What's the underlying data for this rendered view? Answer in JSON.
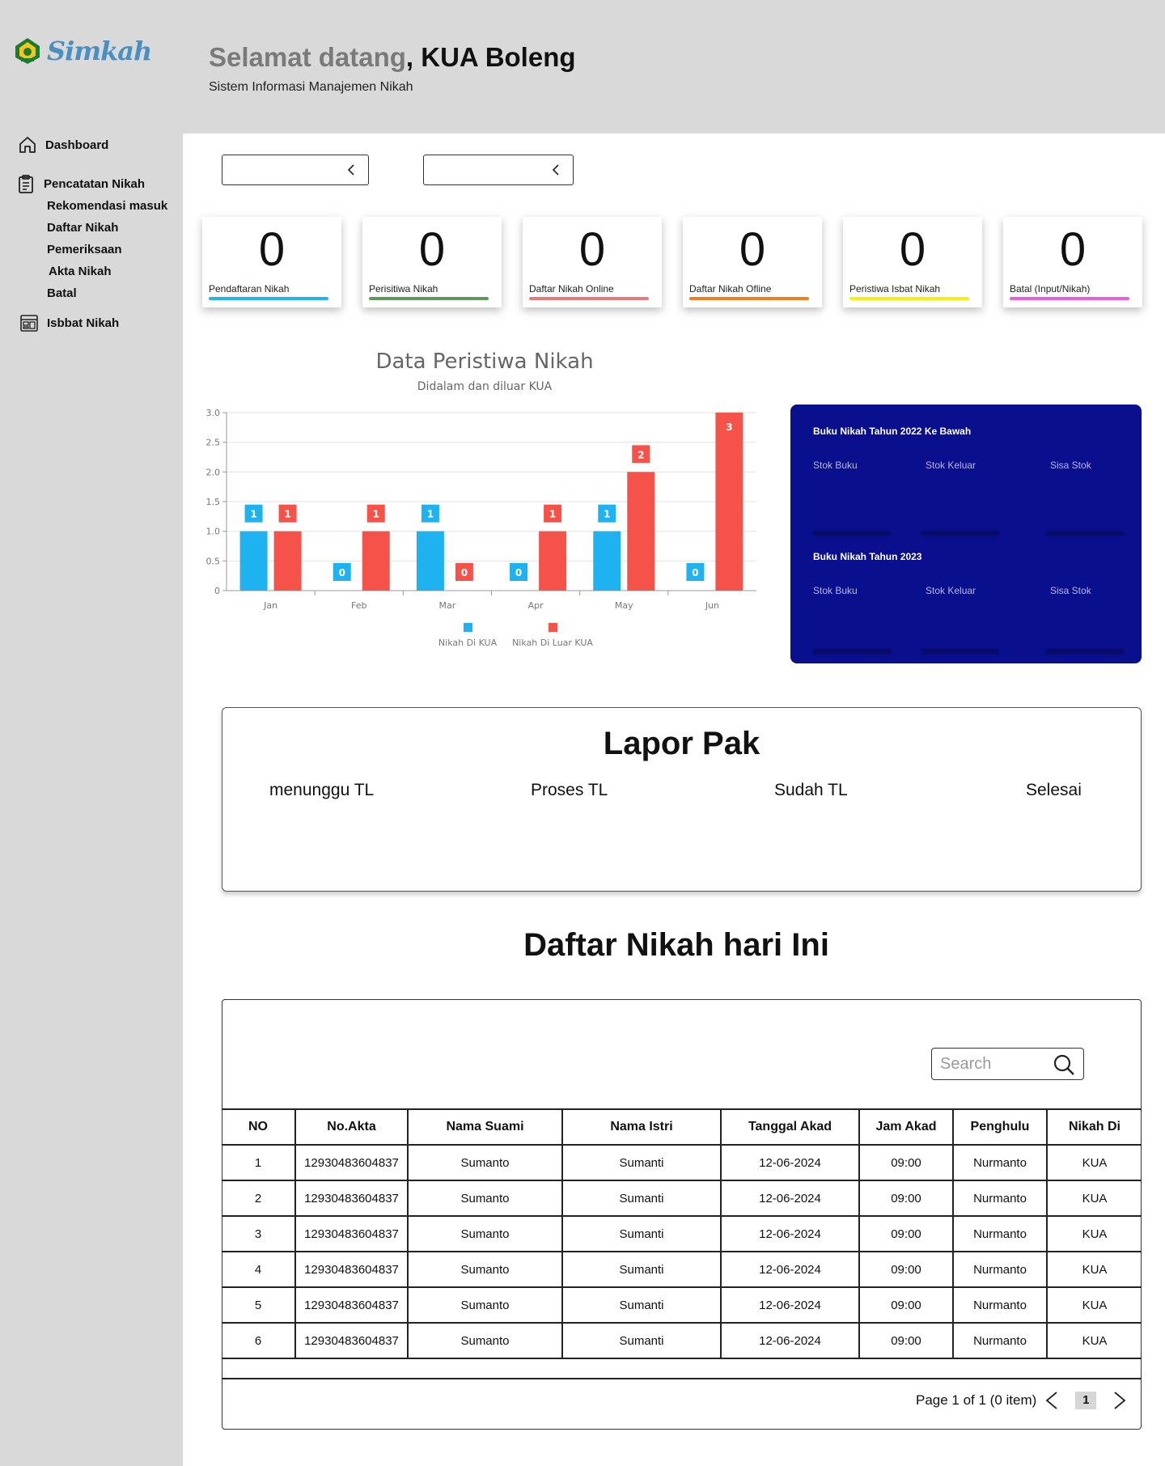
{
  "header": {
    "logo_text": "Simkah",
    "welcome_grey": "Selamat datang",
    "welcome_dark": ", KUA Boleng",
    "subtitle": "Sistem Informasi Manajemen Nikah"
  },
  "sidebar": {
    "dashboard": "Dashboard",
    "pencatatan": "Pencatatan Nikah",
    "subs": [
      "Rekomendasi masuk",
      "Daftar Nikah",
      "Pemeriksaan",
      "Akta Nikah",
      "Batal"
    ],
    "isbbat": "Isbbat Nikah"
  },
  "stats": [
    {
      "value": "0",
      "label": "Pendaftaran Nikah",
      "color": "#1fb6ec"
    },
    {
      "value": "0",
      "label": "Perisitiwa Nikah",
      "color": "#5c9a59"
    },
    {
      "value": "0",
      "label": "Daftar Nikah Online",
      "color": "#e77a7a"
    },
    {
      "value": "0",
      "label": "Daftar Nikah Ofline",
      "color": "#ef7f1a"
    },
    {
      "value": "0",
      "label": "Peristiwa Isbat Nikah",
      "color": "#f2f20c"
    },
    {
      "value": "0",
      "label": "Batal (Input/Nikah)",
      "color": "#e75ee0"
    }
  ],
  "chart_data": {
    "type": "bar",
    "title": "Data Peristiwa Nikah",
    "subtitle": "Didalam dan diluar KUA",
    "categories": [
      "Jan",
      "Feb",
      "Mar",
      "Apr",
      "May",
      "Jun"
    ],
    "series": [
      {
        "name": "Nikah Di KUA",
        "values": [
          1,
          0,
          1,
          0,
          1,
          0
        ],
        "color": "#1fb2f0"
      },
      {
        "name": "Nikah Di Luar KUA",
        "values": [
          1,
          1,
          0,
          1,
          2,
          3
        ],
        "color": "#f5534a"
      }
    ],
    "ylim": [
      0,
      3
    ],
    "yticks": [
      "0",
      "0.5",
      "1.0",
      "1.5",
      "2.0",
      "2.5",
      "3.0"
    ],
    "grid": true,
    "legend": "bottom"
  },
  "stock": {
    "section1": "Buku Nikah Tahun 2022 Ke Bawah",
    "section2": "Buku Nikah Tahun 2023",
    "cols": [
      "Stok Buku",
      "Stok Keluar",
      "Sisa Stok"
    ],
    "bg": "#0a0f8e"
  },
  "lapor": {
    "title": "Lapor Pak",
    "items": [
      "menunggu TL",
      "Proses TL",
      "Sudah TL",
      "Selesai"
    ]
  },
  "daftar_title": "Daftar Nikah hari Ini",
  "search_placeholder": "Search",
  "table": {
    "headers": [
      "NO",
      "No.Akta",
      "Nama Suami",
      "Nama Istri",
      "Tanggal Akad",
      "Jam Akad",
      "Penghulu",
      "Nikah Di"
    ],
    "rows": [
      [
        "1",
        "12930483604837",
        "Sumanto",
        "Sumanti",
        "12-06-2024",
        "09:00",
        "Nurmanto",
        "KUA"
      ],
      [
        "2",
        "12930483604837",
        "Sumanto",
        "Sumanti",
        "12-06-2024",
        "09:00",
        "Nurmanto",
        "KUA"
      ],
      [
        "3",
        "12930483604837",
        "Sumanto",
        "Sumanti",
        "12-06-2024",
        "09:00",
        "Nurmanto",
        "KUA"
      ],
      [
        "4",
        "12930483604837",
        "Sumanto",
        "Sumanti",
        "12-06-2024",
        "09:00",
        "Nurmanto",
        "KUA"
      ],
      [
        "5",
        "12930483604837",
        "Sumanto",
        "Sumanti",
        "12-06-2024",
        "09:00",
        "Nurmanto",
        "KUA"
      ],
      [
        "6",
        "12930483604837",
        "Sumanto",
        "Sumanti",
        "12-06-2024",
        "09:00",
        "Nurmanto",
        "KUA"
      ]
    ]
  },
  "pager": {
    "text": "Page 1 of  1 (0 item)",
    "current": "1"
  }
}
